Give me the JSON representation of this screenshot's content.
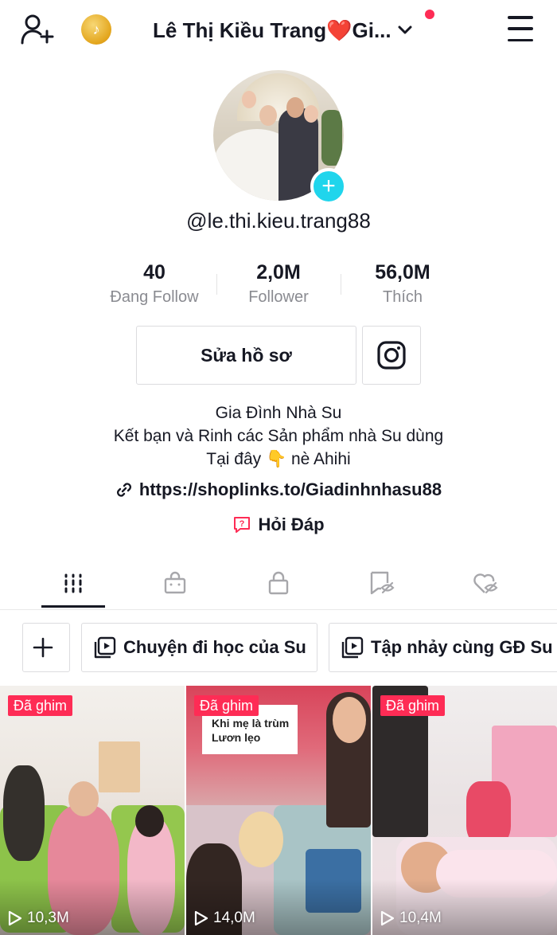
{
  "header": {
    "title": "Lê Thị Kiều Trang❤️Gi...",
    "add_friend_icon": "add-user-icon",
    "coin_icon": "coin-icon",
    "menu_icon": "hamburger-menu-icon"
  },
  "profile": {
    "handle": "@le.thi.kieu.trang88",
    "stats": [
      {
        "value": "40",
        "label": "Đang Follow"
      },
      {
        "value": "2,0M",
        "label": "Follower"
      },
      {
        "value": "56,0M",
        "label": "Thích"
      }
    ],
    "edit_button": "Sửa hồ sơ",
    "bio_lines": [
      "Gia Đình Nhà Su",
      "Kết bạn và Rinh các Sản phẩm nhà Su dùng",
      "Tại đây 👇 nè Ahihi"
    ],
    "link": "https://shoplinks.to/Giadinhnhasu88",
    "qa": "Hỏi Đáp"
  },
  "tabs": [
    "videos-grid",
    "shop",
    "private",
    "reposts",
    "liked"
  ],
  "playlists": [
    {
      "label": "Chuyện đi học của Su"
    },
    {
      "label": "Tập nhảy cùng GĐ Su"
    }
  ],
  "videos": [
    {
      "pinned": "Đã ghim",
      "views": "10,3M"
    },
    {
      "pinned": "Đã ghim",
      "views": "14,0M",
      "caption": "Khi mẹ là trùm Lươn lẹo"
    },
    {
      "pinned": "Đã ghim",
      "views": "10,4M"
    }
  ],
  "colors": {
    "accent": "#fe2c55",
    "avatar_plus": "#20d5ec",
    "muted": "#8a8b91"
  }
}
